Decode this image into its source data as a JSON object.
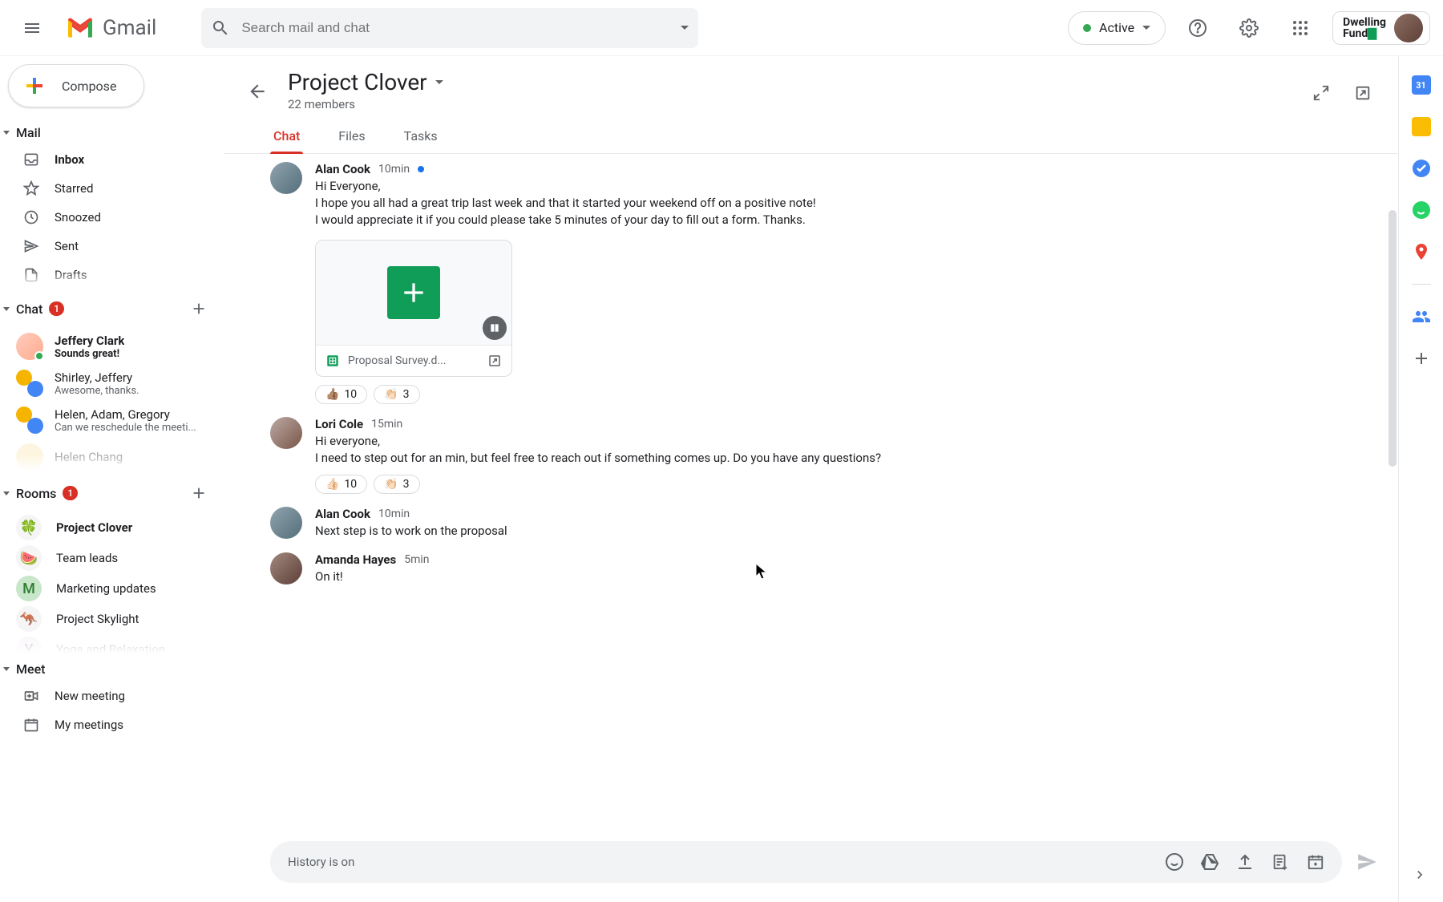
{
  "header": {
    "app_name": "Gmail",
    "search_placeholder": "Search mail and chat",
    "status_label": "Active",
    "workspace_name": "Dwelling\nFund"
  },
  "compose_label": "Compose",
  "sections": {
    "mail": {
      "title": "Mail",
      "items": [
        {
          "icon": "inbox",
          "label": "Inbox",
          "bold": true
        },
        {
          "icon": "star",
          "label": "Starred"
        },
        {
          "icon": "clock",
          "label": "Snoozed"
        },
        {
          "icon": "send",
          "label": "Sent"
        },
        {
          "icon": "draft",
          "label": "Drafts"
        }
      ]
    },
    "chat": {
      "title": "Chat",
      "badge": "1",
      "items": [
        {
          "name": "Jeffery Clark",
          "preview": "Sounds great!",
          "bold": true,
          "status": true
        },
        {
          "name": "Shirley, Jeffery",
          "preview": "Awesome, thanks.",
          "multi": true
        },
        {
          "name": "Helen, Adam, Gregory",
          "preview": "Can we reschedule the meeti...",
          "multi": true
        }
      ]
    },
    "rooms": {
      "title": "Rooms",
      "badge": "1",
      "items": [
        {
          "emoji": "🍀",
          "label": "Project Clover",
          "bold": true
        },
        {
          "emoji": "🍉",
          "label": "Team leads"
        },
        {
          "emoji": "M",
          "label": "Marketing updates",
          "letter": true
        },
        {
          "emoji": "🦘",
          "label": "Project Skylight"
        }
      ]
    },
    "meet": {
      "title": "Meet",
      "items": [
        {
          "icon": "video",
          "label": "New meeting"
        },
        {
          "icon": "calendar",
          "label": "My meetings"
        }
      ]
    }
  },
  "room": {
    "title": "Project Clover",
    "members": "22 members",
    "tabs": [
      "Chat",
      "Files",
      "Tasks"
    ],
    "active_tab": 0
  },
  "messages": [
    {
      "author": "Alan Cook",
      "time": "10min",
      "unread": true,
      "lines": [
        "Hi Everyone,",
        "I hope you all had a great trip last week and that it started your weekend off on a positive note!",
        "I would appreciate it if you could please take 5 minutes of your day to fill out a form. Thanks."
      ],
      "attachment": {
        "name": "Proposal Survey.d...",
        "type": "sheets"
      },
      "reactions": [
        {
          "emoji": "👍🏽",
          "count": "10"
        },
        {
          "emoji": "👏🏻",
          "count": "3"
        }
      ]
    },
    {
      "author": "Lori Cole",
      "time": "15min",
      "lines": [
        "Hi everyone,",
        "I need to step out for an min, but feel free to reach out if something comes up.  Do you have any questions?"
      ],
      "reactions": [
        {
          "emoji": "👍🏻",
          "count": "10"
        },
        {
          "emoji": "👏🏻",
          "count": "3"
        }
      ]
    },
    {
      "author": "Alan Cook",
      "time": "10min",
      "lines": [
        "Next step is to work on the proposal"
      ]
    },
    {
      "author": "Amanda Hayes",
      "time": "5min",
      "lines": [
        "On it!"
      ]
    }
  ],
  "composer": {
    "placeholder": "History is on"
  }
}
